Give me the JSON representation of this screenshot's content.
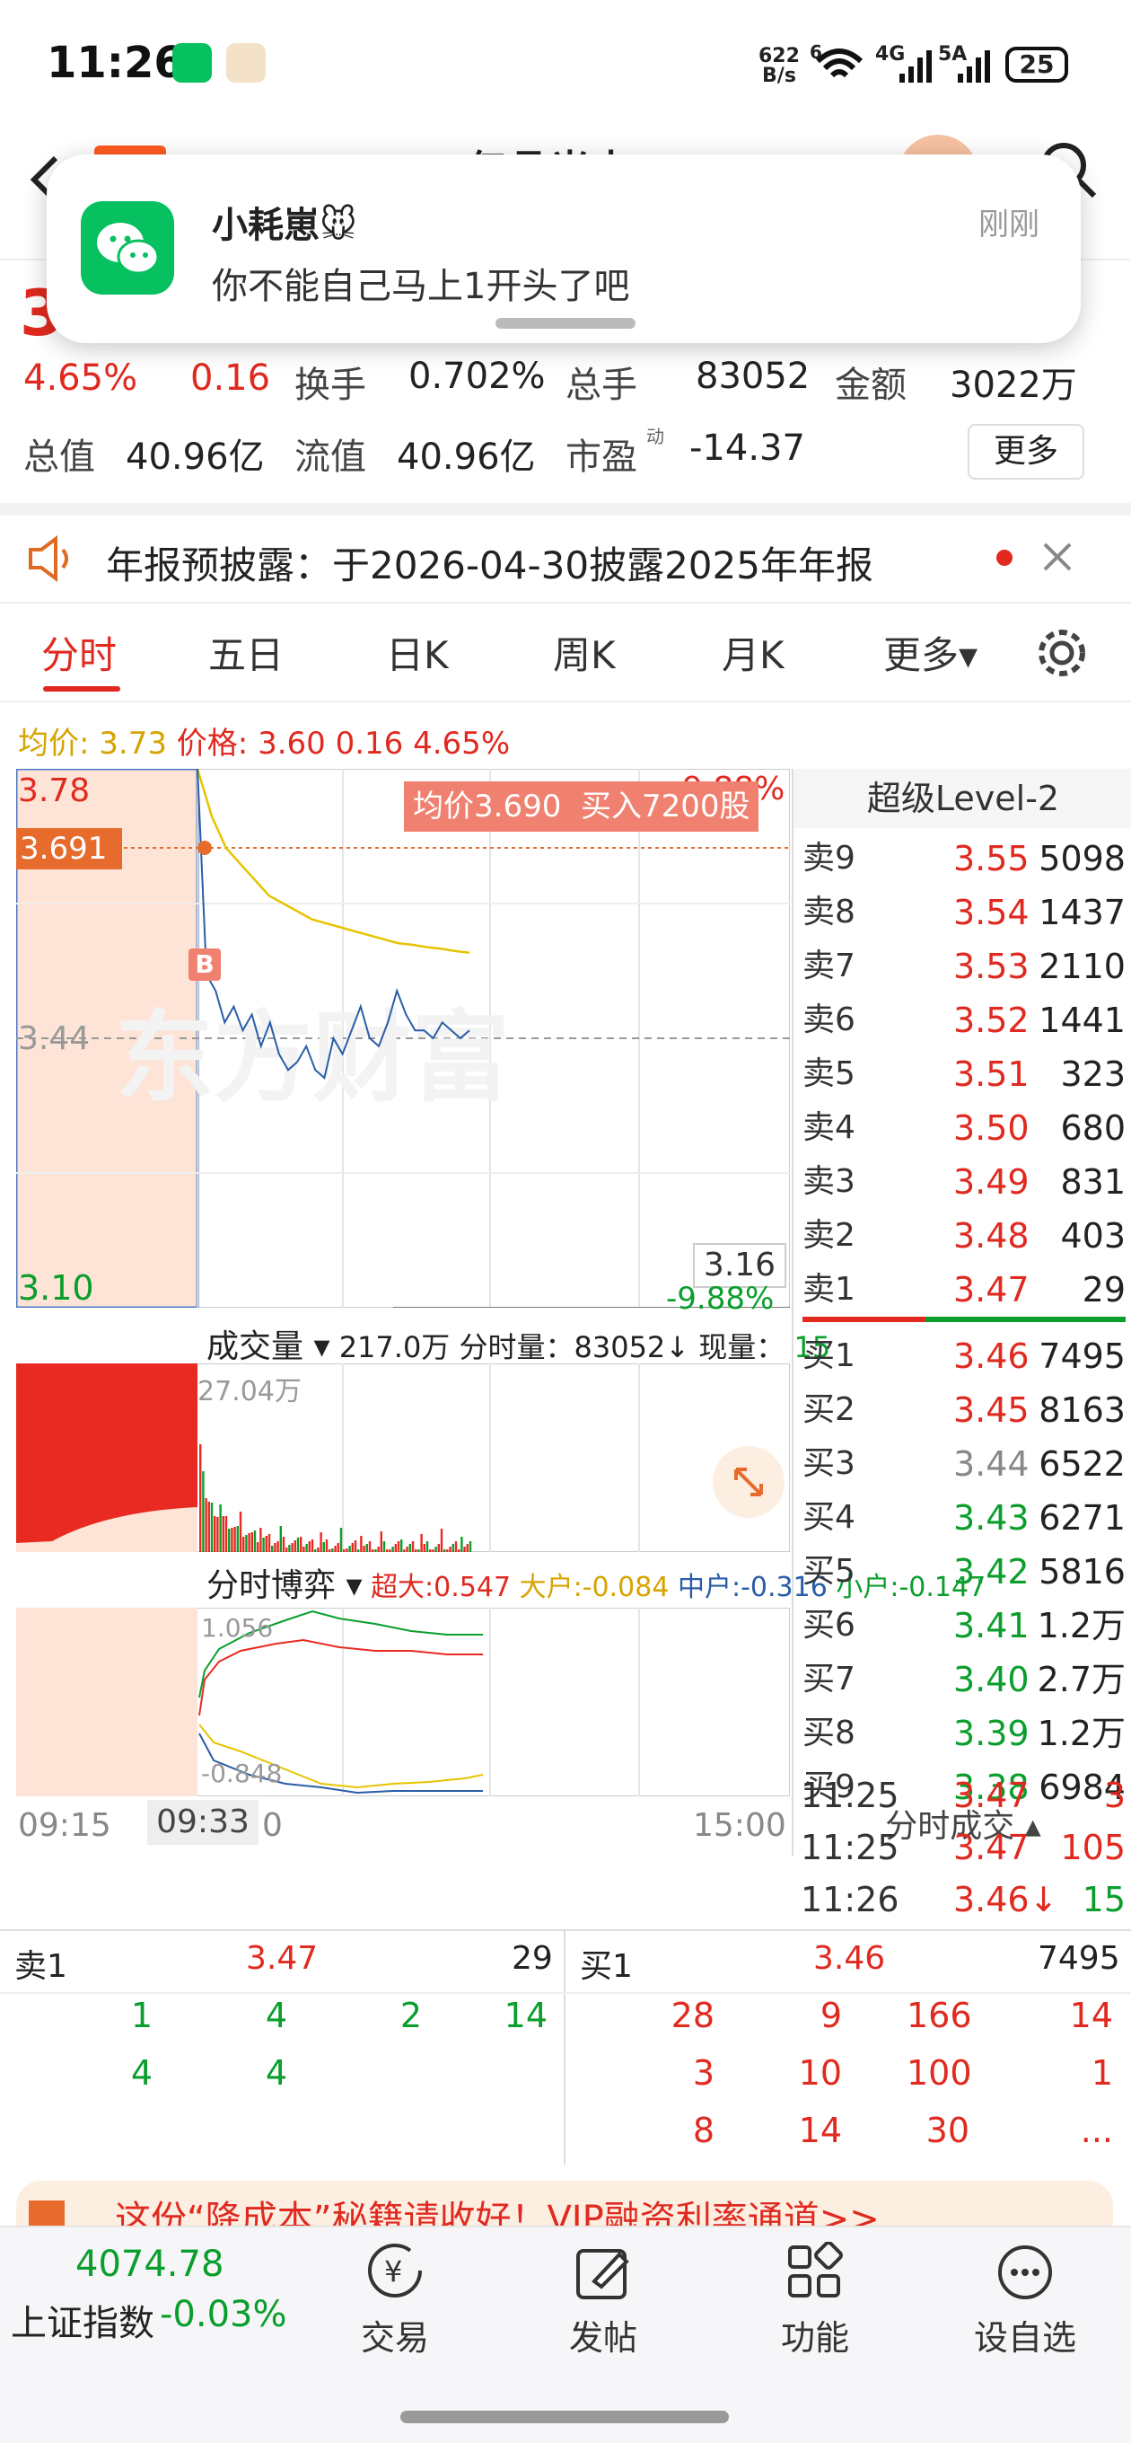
{
  "status": {
    "time": "11:26",
    "net_speed_top": "622",
    "net_speed_unit": "B/s",
    "sig1": "6",
    "sig2": "4G",
    "sig3": "5A",
    "battery": "25"
  },
  "header": {
    "title": "亿晶光电"
  },
  "notification": {
    "sender": "小耗崽🐭",
    "message": "你不能自己马上1开头了吧",
    "time": "刚刚"
  },
  "quote": {
    "price_partial": "3.",
    "change_pct": "4.65%",
    "change": "0.16",
    "turnover_label": "换手",
    "turnover": "0.702%",
    "volume_label": "总手",
    "volume": "83052",
    "amount_label": "金额",
    "amount": "3022万",
    "mcap_label": "总值",
    "mcap": "40.96亿",
    "float_label": "流值",
    "float": "40.96亿",
    "pe_label": "市盈",
    "pe_sup": "动",
    "pe": "-14.37",
    "more": "更多"
  },
  "notice": {
    "text": "年报预披露：于2026-04-30披露2025年年报"
  },
  "tabs": [
    "分时",
    "五日",
    "日K",
    "周K",
    "月K",
    "更多▾"
  ],
  "chart": {
    "avg_label": "均价:",
    "avg": "3.73",
    "price_label": "价格:",
    "price": "3.60",
    "chg": "0.16",
    "pct": "4.65%",
    "y_high": "3.78",
    "y_cross": "3.691",
    "y_mid": "3.44",
    "y_low": "3.10",
    "right_top": "9.88%",
    "right_bottom": "-9.88%",
    "right_price": "3.16",
    "tooltip": "均价3.690  买入7200股",
    "buy_mark": "B",
    "watermark": "东方财富",
    "vol_label": "成交量 ▾",
    "vol_total": "217.0万",
    "vol_info": "分时量：83052↓ 现量：",
    "vol_now": "15",
    "vol_max": "27.04万",
    "game_label": "分时博弈 ▾",
    "game_super": "超大:0.547",
    "game_big": "大户:-0.084",
    "game_mid": "中户:-0.316",
    "game_small": "小户:-0.147",
    "game_top": "1.056",
    "game_bottom": "-0.848",
    "time_start": "09:15",
    "time_cursor": "09:33",
    "time_cursor_tail": "0",
    "time_end": "15:00",
    "avg_series": [
      3.78,
      3.72,
      3.68,
      3.66,
      3.64,
      3.62,
      3.61,
      3.6,
      3.59,
      3.585,
      3.58,
      3.575,
      3.57,
      3.565,
      3.56,
      3.558,
      3.555,
      3.553,
      3.55,
      3.548
    ],
    "price_series": [
      3.78,
      3.52,
      3.5,
      3.46,
      3.48,
      3.45,
      3.47,
      3.43,
      3.46,
      3.42,
      3.4,
      3.41,
      3.43,
      3.4,
      3.39,
      3.44,
      3.42,
      3.45,
      3.48,
      3.44,
      3.43,
      3.46,
      3.5,
      3.47,
      3.45,
      3.45,
      3.44,
      3.46,
      3.45,
      3.44,
      3.45
    ]
  },
  "level2": {
    "title": "超级Level-2",
    "asks": [
      {
        "l": "卖9",
        "p": "3.55",
        "v": "5098"
      },
      {
        "l": "卖8",
        "p": "3.54",
        "v": "1437"
      },
      {
        "l": "卖7",
        "p": "3.53",
        "v": "2110"
      },
      {
        "l": "卖6",
        "p": "3.52",
        "v": "1441"
      },
      {
        "l": "卖5",
        "p": "3.51",
        "v": "323"
      },
      {
        "l": "卖4",
        "p": "3.50",
        "v": "680"
      },
      {
        "l": "卖3",
        "p": "3.49",
        "v": "831"
      },
      {
        "l": "卖2",
        "p": "3.48",
        "v": "403"
      },
      {
        "l": "卖1",
        "p": "3.47",
        "v": "29"
      }
    ],
    "bids": [
      {
        "l": "买1",
        "p": "3.46",
        "v": "7495",
        "c": "red"
      },
      {
        "l": "买2",
        "p": "3.45",
        "v": "8163",
        "c": "red"
      },
      {
        "l": "买3",
        "p": "3.44",
        "v": "6522",
        "c": "gray"
      },
      {
        "l": "买4",
        "p": "3.43",
        "v": "6271",
        "c": "green"
      },
      {
        "l": "买5",
        "p": "3.42",
        "v": "5816",
        "c": "green"
      },
      {
        "l": "买6",
        "p": "3.41",
        "v": "1.2万",
        "c": "green"
      },
      {
        "l": "买7",
        "p": "3.40",
        "v": "2.7万",
        "c": "green"
      },
      {
        "l": "买8",
        "p": "3.39",
        "v": "1.2万",
        "c": "green"
      },
      {
        "l": "买9",
        "p": "3.38",
        "v": "6984",
        "c": "green"
      }
    ],
    "trades_title": "分时成交 ▴",
    "trades": [
      {
        "t": "11:25",
        "p": "3.47",
        "v": "3"
      },
      {
        "t": "11:25",
        "p": "3.47",
        "v": "105"
      },
      {
        "t": "11:26",
        "p": "3.46↓",
        "v": "15"
      }
    ]
  },
  "queue": {
    "ask_label": "卖1",
    "ask_price": "3.47",
    "ask_vol": "29",
    "bid_label": "买1",
    "bid_price": "3.46",
    "bid_vol": "7495",
    "ask_row1": [
      "1",
      "4",
      "2",
      "14"
    ],
    "ask_row2": [
      "4",
      "4"
    ],
    "bid_row1": [
      "28",
      "9",
      "166",
      "14"
    ],
    "bid_row2": [
      "3",
      "10",
      "100",
      "1"
    ],
    "bid_row3": [
      "8",
      "14",
      "30",
      "..."
    ]
  },
  "banner": {
    "text": "这份“降成本”秘籍请收好！VIP融资利率通道>>"
  },
  "bottom": {
    "index_value": "4074.78",
    "index_name": "上证指数",
    "index_chg": "-0.03%",
    "items": [
      "交易",
      "发帖",
      "功能",
      "设自选"
    ]
  }
}
